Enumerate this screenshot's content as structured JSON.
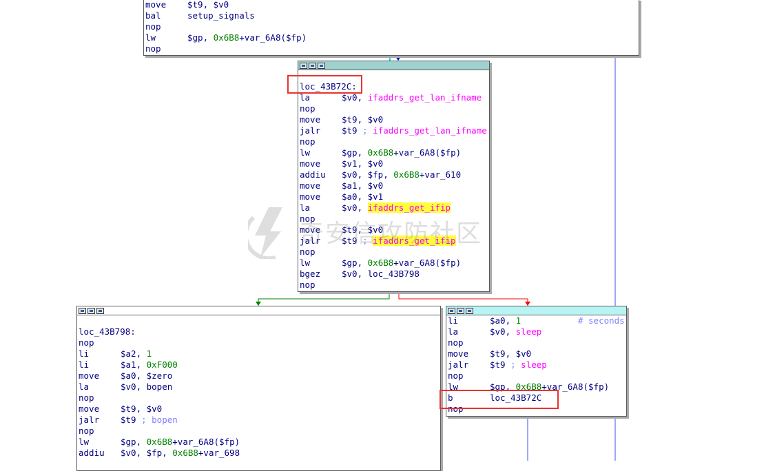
{
  "top_block": {
    "lines": [
      {
        "op": "move",
        "args": "$t9, $v0"
      },
      {
        "op": "bal",
        "args": "setup_signals"
      },
      {
        "op": "nop",
        "args": ""
      },
      {
        "op": "lw",
        "args_reg": "$gp, ",
        "args_num": "0x6B8",
        "args_tail": "+var_6A8($fp)"
      },
      {
        "op": "nop",
        "args": ""
      }
    ]
  },
  "center_block": {
    "label": "loc_43B72C:",
    "lines": [
      {
        "op": "la",
        "a": "$v0, ",
        "f": "ifaddrs_get_lan_ifname"
      },
      {
        "op": "nop"
      },
      {
        "op": "move",
        "a": "$t9, $v0"
      },
      {
        "op": "jalr",
        "a": "$t9 ",
        "c": "; ",
        "f": "ifaddrs_get_lan_ifname"
      },
      {
        "op": "nop"
      },
      {
        "op": "lw",
        "a": "$gp, ",
        "n": "0x6B8",
        "t": "+var_6A8($fp)"
      },
      {
        "op": "move",
        "a": "$v1, $v0"
      },
      {
        "op": "addiu",
        "a": "$v0, $fp, ",
        "n": "0x6B8",
        "t": "+var_610"
      },
      {
        "op": "move",
        "a": "$a1, $v0"
      },
      {
        "op": "move",
        "a": "$a0, $v1"
      },
      {
        "op": "la",
        "a": "$v0, ",
        "f": "ifaddrs_get_ifip"
      },
      {
        "op": "nop"
      },
      {
        "op": "move",
        "a": "$t9, $v0"
      },
      {
        "op": "jalr",
        "a": "$t9 ",
        "c": "; ",
        "f": "ifaddrs_get_ifip"
      },
      {
        "op": "nop"
      },
      {
        "op": "lw",
        "a": "$gp, ",
        "n": "0x6B8",
        "t": "+var_6A8($fp)"
      },
      {
        "op": "bgez",
        "a": "$v0, loc_43B798"
      },
      {
        "op": "nop"
      }
    ]
  },
  "left_block": {
    "label": "loc_43B798:",
    "lines": [
      {
        "op": "nop"
      },
      {
        "op": "li",
        "a": "$a2, ",
        "n": "1"
      },
      {
        "op": "li",
        "a": "$a1, ",
        "n": "0xF000"
      },
      {
        "op": "move",
        "a": "$a0, $zero"
      },
      {
        "op": "la",
        "a": "$v0, bopen"
      },
      {
        "op": "nop"
      },
      {
        "op": "move",
        "a": "$t9, $v0"
      },
      {
        "op": "jalr",
        "a": "$t9 ",
        "c": "; bopen"
      },
      {
        "op": "nop"
      },
      {
        "op": "lw",
        "a": "$gp, ",
        "n": "0x6B8",
        "t": "+var_6A8($fp)"
      },
      {
        "op": "addiu",
        "a": "$v0, $fp, ",
        "n": "0x6B8",
        "t": "+var_698"
      }
    ]
  },
  "right_block": {
    "lines": [
      {
        "op": "li",
        "a": "$a0, ",
        "n": "1",
        "c": "# seconds"
      },
      {
        "op": "la",
        "a": "$v0, ",
        "f": "sleep"
      },
      {
        "op": "nop"
      },
      {
        "op": "move",
        "a": "$t9, $v0"
      },
      {
        "op": "jalr",
        "a": "$t9 ",
        "c": "; ",
        "f": "sleep"
      },
      {
        "op": "nop"
      },
      {
        "op": "lw",
        "a": "$gp, ",
        "n": "0x6B8",
        "t": "+var_6A8($fp)"
      },
      {
        "op": "b",
        "a": "loc_43B72C"
      },
      {
        "op": "nop"
      }
    ]
  },
  "watermark": {
    "text": "奇安信攻防社区"
  },
  "colors": {
    "mnemonic": "#000080",
    "number": "#008000",
    "function": "#ff00ff",
    "comment": "#8080ff",
    "highlight": "#ffff3b",
    "highlight_box": "#e8332e",
    "edge_true": "#008000",
    "edge_false": "#ff0000",
    "edge_back": "#0000ff"
  }
}
